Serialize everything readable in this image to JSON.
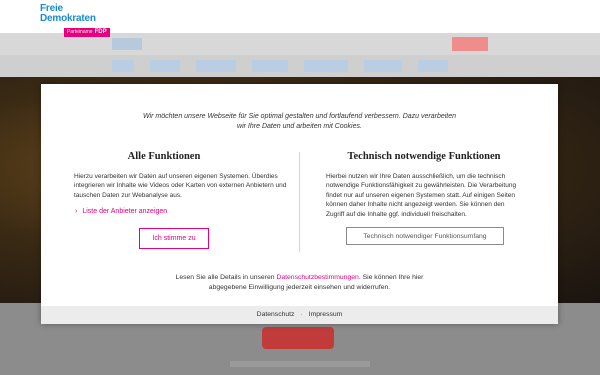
{
  "brand": {
    "line1": "Freie",
    "line2": "Demokraten",
    "badge_prefix": "Parteiname",
    "badge": "FDP"
  },
  "modal": {
    "intro": "Wir möchten unsere Webseite für Sie optimal gestalten und fortlaufend verbessern. Dazu verarbeiten wir Ihre Daten und arbeiten mit Cookies.",
    "left": {
      "title": "Alle Funktionen",
      "text": "Hierzu verarbeiten wir Daten auf unseren eigenen Systemen. Überdies integrieren wir Inhalte wie Videos oder Karten von externen Anbietern und tauschen Daten zur Webanalyse aus.",
      "provider_link": "Liste der Anbieter anzeigen",
      "accept_button": "Ich stimme zu"
    },
    "right": {
      "title": "Technisch notwendige Funktionen",
      "text": "Hierbei nutzen wir Ihre Daten ausschließlich, um die technisch notwendige Funktionsfähigkeit zu gewährleisten. Die Verarbeitung findet nur auf unseren eigenen Systemen statt. Auf einigen Seiten können daher Inhalte nicht angezeigt werden. Sie können den Zugriff auf die Inhalte ggf. individuell freischalten.",
      "button": "Technisch notwendiger Funktionsumfang"
    },
    "details": {
      "before": "Lesen Sie alle Details in unseren ",
      "link": "Datenschutzbestimmungen",
      "after": ". Sie können Ihre hier abgegebene Einwilligung jederzeit einsehen und widerrufen."
    },
    "footer": {
      "privacy": "Datenschutz",
      "separator": "·",
      "imprint": "Impressum"
    }
  },
  "colors": {
    "accent": "#e5007d",
    "brand_blue": "#1a8ccd"
  }
}
